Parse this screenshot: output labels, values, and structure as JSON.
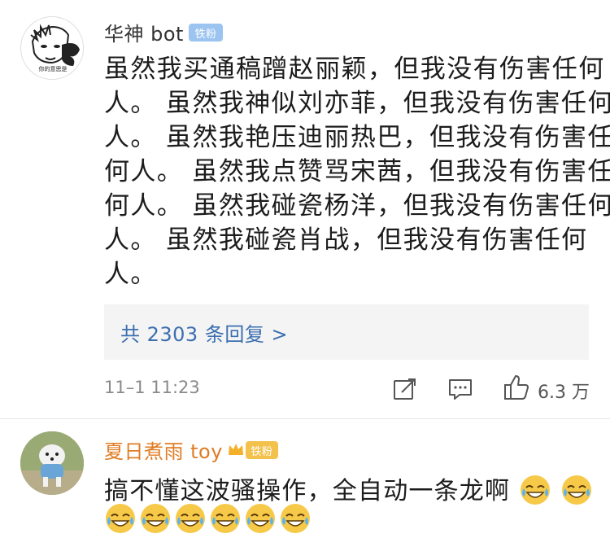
{
  "comment1": {
    "username": "华神 bot",
    "badge": "铁粉",
    "lines": [
      "虽然我买通稿蹭赵丽颖，但我没有伤害任何",
      "人。 虽然我神似刘亦菲，但我没有伤害任何",
      "人。 虽然我艳压迪丽热巴，但我没有伤害任",
      "何人。 虽然我点赞骂宋茜，但我没有伤害任",
      "何人。 虽然我碰瓷杨洋，但我没有伤害任何",
      "人。 虽然我碰瓷肖战，但我没有伤害任何",
      "人。"
    ],
    "replies_link": "共 2303 条回复 >",
    "timestamp": "11–1 11:23",
    "like_count": "6.3 万",
    "icons": [
      "share-icon",
      "comment-icon",
      "like-icon"
    ]
  },
  "comment2": {
    "username": "夏日煮雨 toy",
    "badge": "铁粉",
    "text": "搞不懂这波骚操作，全自动一条龙啊",
    "emoji": "laughing-tears-icon",
    "emoji_count_inline": 2,
    "emoji_count_row": 6
  },
  "colors": {
    "username_default": "#333333",
    "username_vip": "#e07c24",
    "link_blue": "#3c6fb0",
    "badge_blue": "#9cc4f0",
    "badge_gold": "#f3c24d"
  }
}
